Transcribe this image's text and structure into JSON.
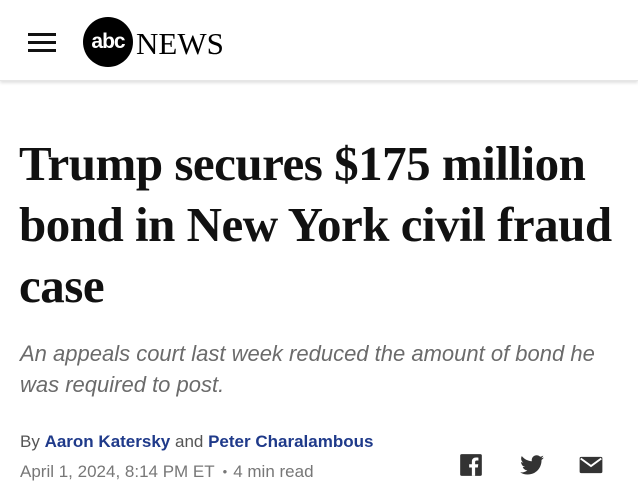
{
  "header": {
    "menu_icon": "hamburger-menu-icon",
    "logo_circle_text": "abc",
    "logo_word": "NEWS"
  },
  "article": {
    "headline": "Trump secures $175 million bond in New York civil fraud case",
    "subheadline": "An appeals court last week reduced the amount of bond he was required to post.",
    "byline_prefix": "By",
    "author_1": "Aaron Katersky",
    "byline_joiner": "and",
    "author_2": "Peter Charalambous",
    "date": "April 1, 2024, 8:14 PM ET",
    "separator": "•",
    "read_time": "4 min read"
  },
  "share": {
    "icons": [
      "facebook-icon",
      "twitter-icon",
      "email-icon"
    ]
  },
  "colors": {
    "author_link": "#1f3a8a",
    "subhead": "#6b6b6b",
    "meta": "#777777",
    "icon": "#333333"
  }
}
